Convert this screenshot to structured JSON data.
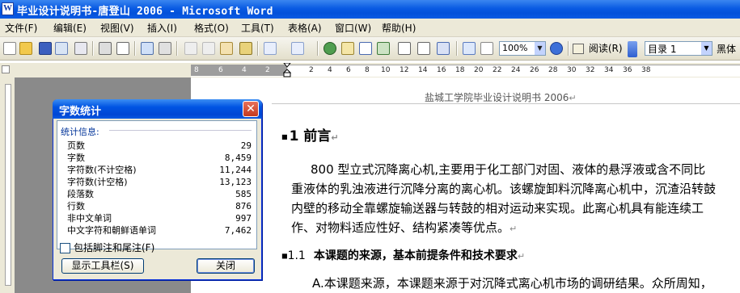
{
  "window": {
    "title": "毕业设计说明书-唐登山 2006 - Microsoft Word"
  },
  "menu": [
    "文件(F)",
    "编辑(E)",
    "视图(V)",
    "插入(I)",
    "格式(O)",
    "工具(T)",
    "表格(A)",
    "窗口(W)",
    "帮助(H)"
  ],
  "toolbar": {
    "zoom": "100%",
    "reading": "阅读(R)",
    "style": "目录 1",
    "font": "黑体"
  },
  "ruler": {
    "ticks": [
      "8",
      "6",
      "4",
      "2",
      "2",
      "4",
      "6",
      "8",
      "10",
      "12",
      "14",
      "16",
      "18",
      "20",
      "22",
      "24",
      "26",
      "28",
      "30",
      "32",
      "34",
      "36",
      "38"
    ]
  },
  "document": {
    "header": "盐城工学院毕业设计说明书 2006",
    "heading1": "1 前言",
    "para1": [
      "800 型立式沉降离心机,主要用于化工部门对固、液体的悬浮液或含不同比",
      "重液体的乳浊液进行沉降分离的离心机。该螺旋卸料沉降离心机中，沉渣沿转鼓",
      "内壁的移动全靠螺旋输送器与转鼓的相对运动来实现。此离心机具有能连续工",
      "作、对物料适应性好、结构紧凑等优点。"
    ],
    "heading2_num": "1.1",
    "heading2_text": "本课题的来源，基本前提条件和技术要求",
    "para2": "A.本课题来源，本课题来源于对沉降式离心机市场的调研结果。众所周知，"
  },
  "dialog": {
    "title": "字数统计",
    "stats_label": "统计信息:",
    "rows": [
      {
        "k": "页数",
        "v": "29"
      },
      {
        "k": "字数",
        "v": "8,459"
      },
      {
        "k": "字符数(不计空格)",
        "v": "11,244"
      },
      {
        "k": "字符数(计空格)",
        "v": "13,123"
      },
      {
        "k": "段落数",
        "v": "585"
      },
      {
        "k": "行数",
        "v": "876"
      },
      {
        "k": "非中文单词",
        "v": "997"
      },
      {
        "k": "中文字符和朝鲜语单词",
        "v": "7,462"
      }
    ],
    "checkbox_label": "包括脚注和尾注(F)",
    "btn_toolbar": "显示工具栏(S)",
    "btn_close": "关闭"
  }
}
